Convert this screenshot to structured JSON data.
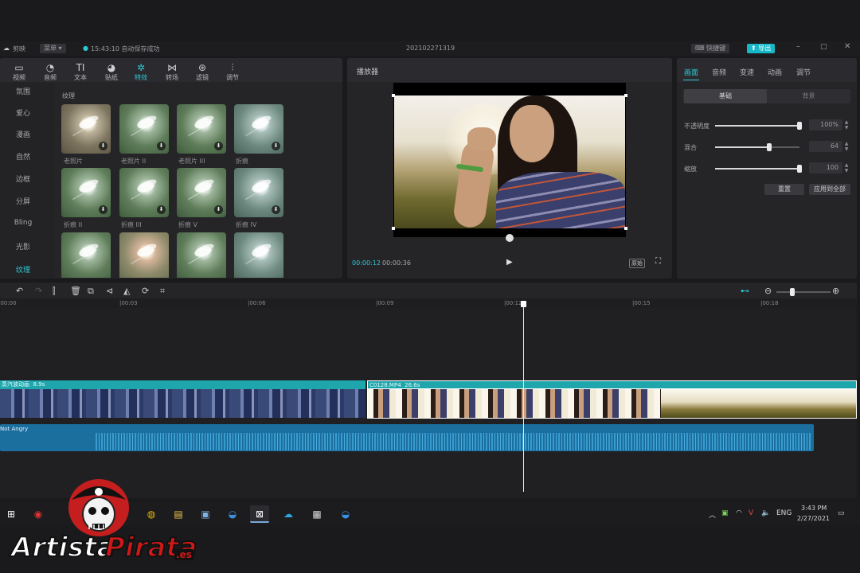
{
  "titlebar": {
    "app_name": "剪映",
    "menu_label": "菜单",
    "status": "15:43:10 自动保存成功",
    "project_name": "202102271319",
    "shortcut_label": "快捷键",
    "export_label": "导出"
  },
  "media_toolbar": {
    "items": [
      "视频",
      "音频",
      "文本",
      "贴纸",
      "特效",
      "转场",
      "滤镜",
      "调节"
    ],
    "active": "特效"
  },
  "effects_sidebar": {
    "items": [
      "氛围",
      "爱心",
      "漫画",
      "自然",
      "边框",
      "分屏",
      "Bling",
      "光影",
      "纹理"
    ],
    "active": "纹理"
  },
  "effects_grid": {
    "section_title": "纹理",
    "thumb_labels": [
      "老照片",
      "老照片 II",
      "老照片 III",
      "折痕",
      "折痕 II",
      "折痕 III",
      "折痕 V",
      "折痕 IV"
    ]
  },
  "player": {
    "title": "播放器",
    "current_time": "00:00:12",
    "total_time": "00:00:36",
    "original_label": "原始"
  },
  "properties": {
    "tabs": [
      "画面",
      "音频",
      "变速",
      "动画",
      "调节"
    ],
    "active_tab": "画面",
    "segments": [
      "基础",
      "背景"
    ],
    "active_segment": "基础",
    "rows": [
      {
        "label": "不透明度",
        "value": "100%",
        "level": 1.0
      },
      {
        "label": "混合",
        "value": "64",
        "level": 0.64
      },
      {
        "label": "缩放",
        "value": "100",
        "level": 1.0
      }
    ],
    "reset_label": "重置",
    "apply_all_label": "应用到全部"
  },
  "timeline": {
    "ticks": [
      "|00:00",
      "|00:03",
      "|00:06",
      "|00:09",
      "|00:12",
      "|00:15",
      "|00:18"
    ],
    "clip_a_name": "蒸汽波动画",
    "clip_a_duration": "8.9s",
    "clip_b_name": "C0128.MP4",
    "clip_b_duration": "26.6s",
    "audio_name": "Not Angry",
    "playhead_time": 12,
    "zoom_level": 0.3
  },
  "taskbar": {
    "language": "ENG",
    "time": "3:43 PM",
    "date": "2/27/2021"
  },
  "watermark": {
    "text_a": "Artista",
    "text_b": "Pirata",
    "suffix": ".es"
  },
  "colors": {
    "accent": "#2ec8d6",
    "clip_teal": "#1fa6ac",
    "audio_blue": "#1b6f9f",
    "panel": "#252528"
  }
}
